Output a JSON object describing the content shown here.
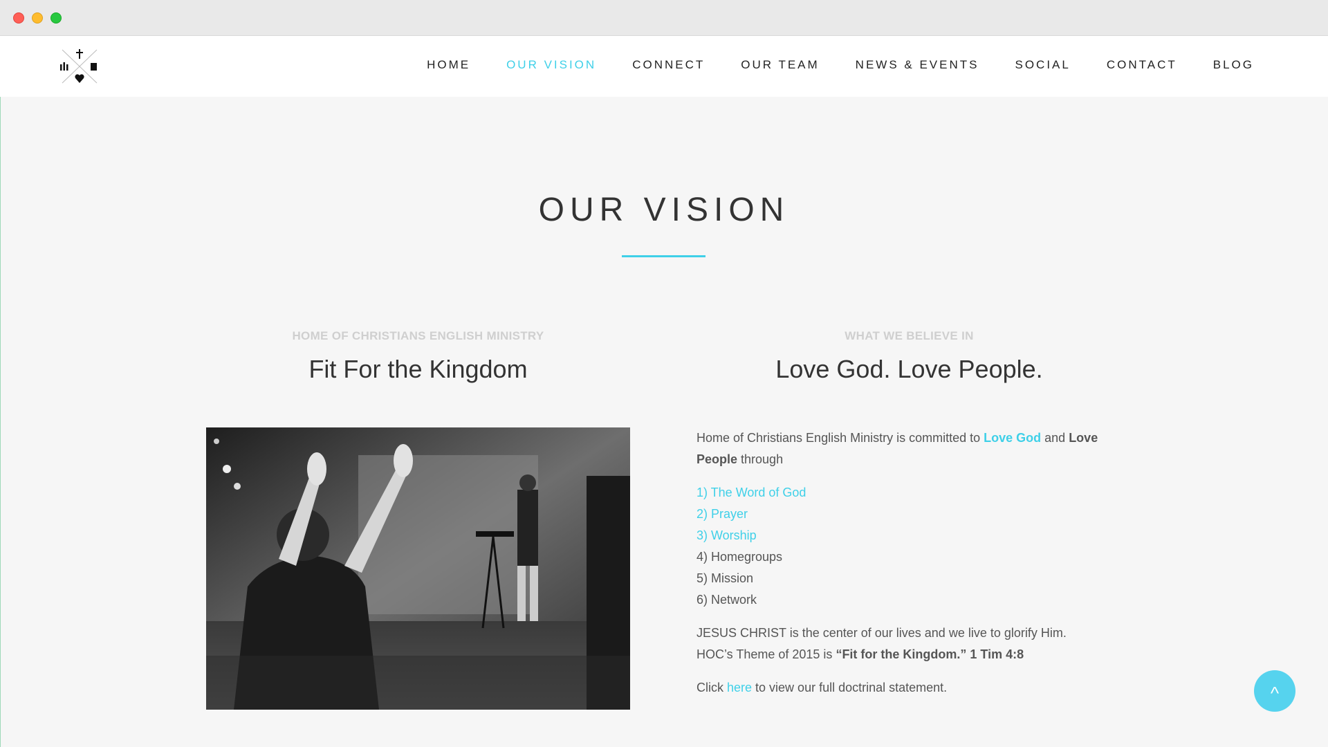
{
  "nav": {
    "items": [
      {
        "label": "HOME",
        "active": false
      },
      {
        "label": "OUR VISION",
        "active": true
      },
      {
        "label": "CONNECT",
        "active": false
      },
      {
        "label": "OUR TEAM",
        "active": false
      },
      {
        "label": "NEWS & EVENTS",
        "active": false
      },
      {
        "label": "SOCIAL",
        "active": false
      },
      {
        "label": "CONTACT",
        "active": false
      },
      {
        "label": "BLOG",
        "active": false
      }
    ]
  },
  "page": {
    "title": "OUR VISION"
  },
  "left": {
    "eyebrow": "HOME OF CHRISTIANS ENGLISH MINISTRY",
    "heading": "Fit For the Kingdom",
    "photo_icon": "worship-photo"
  },
  "right": {
    "eyebrow": "WHAT WE BELIEVE IN",
    "heading": "Love God. Love People.",
    "intro_a": "Home of Christians English Ministry is committed to ",
    "intro_love_god": "Love God",
    "intro_and": " and ",
    "intro_love_people": "Love People",
    "intro_through": " through",
    "list": [
      {
        "text": "1) The Word of God",
        "link": true
      },
      {
        "text": "2) Prayer",
        "link": true
      },
      {
        "text": "3) Worship",
        "link": true
      },
      {
        "text": "4) Homegroups",
        "link": false
      },
      {
        "text": "5) Mission",
        "link": false
      },
      {
        "text": "6) Network",
        "link": false
      }
    ],
    "center_line": "JESUS CHRIST is the center of our lives and we live to glorify Him.",
    "theme_a": "HOC’s Theme of 2015 is ",
    "theme_b": "“Fit for the Kingdom.” 1 Tim 4:8",
    "click_a": "Click ",
    "click_link": "here",
    "click_b": " to view our full doctrinal statement."
  },
  "back_to_top": {
    "label": "^"
  },
  "colors": {
    "accent": "#3fd0e8",
    "background": "#f6f6f6",
    "text": "#555555"
  }
}
